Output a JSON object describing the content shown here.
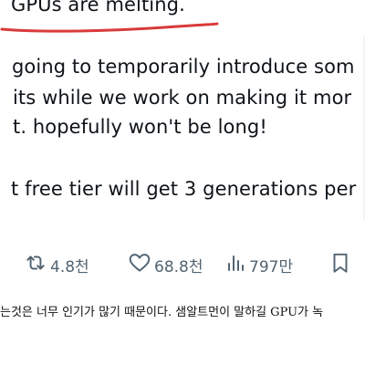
{
  "tweet": {
    "lines": [
      "GPUs are melting.",
      "going to temporarily introduce som",
      "its while we work on making it mor",
      "t. hopefully won't be long!",
      "t free tier will get 3 generations per"
    ]
  },
  "actions": {
    "retweets": "4.8천",
    "likes": "68.8천",
    "views": "797만"
  },
  "caption": "는것은 너무 인기가 많기 때문이다. 샘알트먼이 말하길 GPU가 녹",
  "colors": {
    "underline": "#d93a3a",
    "icon": "#536471",
    "text": "#0f1419"
  },
  "icons": [
    "retweet-icon",
    "heart-icon",
    "views-icon",
    "bookmark-icon"
  ]
}
